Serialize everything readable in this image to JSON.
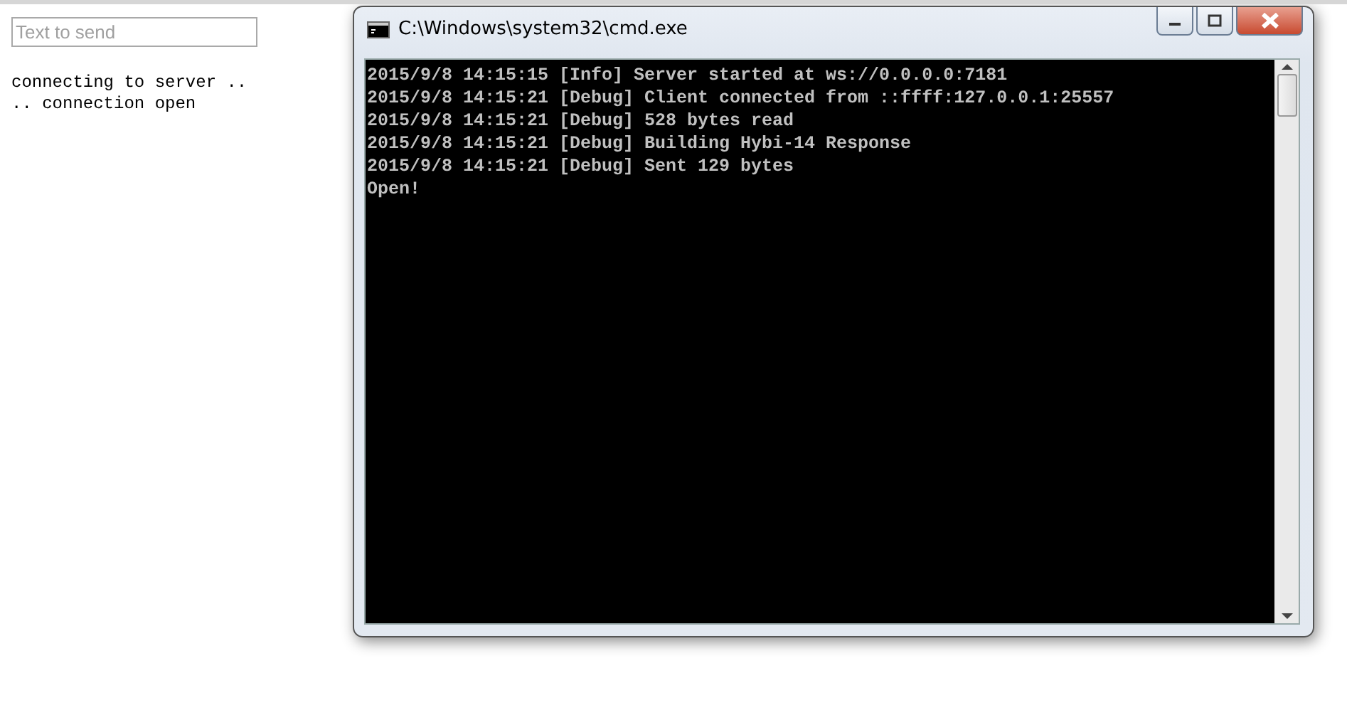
{
  "send_field": {
    "placeholder": "Text to send"
  },
  "log": [
    "connecting to server ..",
    ".. connection open"
  ],
  "console_window": {
    "title": "C:\\Windows\\system32\\cmd.exe",
    "lines": [
      "2015/9/8 14:15:15 [Info] Server started at ws://0.0.0.0:7181",
      "2015/9/8 14:15:21 [Debug] Client connected from ::ffff:127.0.0.1:25557",
      "2015/9/8 14:15:21 [Debug] 528 bytes read",
      "2015/9/8 14:15:21 [Debug] Building Hybi-14 Response",
      "2015/9/8 14:15:21 [Debug] Sent 129 bytes",
      "Open!"
    ]
  }
}
